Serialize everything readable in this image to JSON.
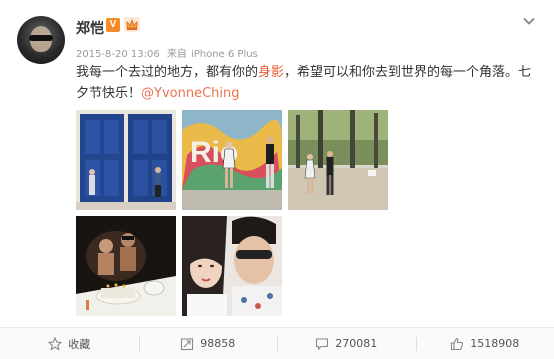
{
  "post": {
    "author": "郑恺",
    "verified_badge": "V",
    "timestamp": "2015-8-20 13:06",
    "source_prefix": "来自",
    "source": "iPhone 6 Plus",
    "text_part1": "我每一个去过的地方，都有你的",
    "text_highlight": "身影",
    "text_part2": "，希望可以和你去到世界的每一个角落。七夕节快乐！",
    "mention": "@YvonneChing"
  },
  "actions": {
    "favorite": "收藏",
    "repost_count": "98858",
    "comment_count": "270081",
    "like_count": "1518908"
  },
  "colors": {
    "highlight": "#e85d2f",
    "mention": "#eb7350",
    "badge": "#f28c28"
  }
}
